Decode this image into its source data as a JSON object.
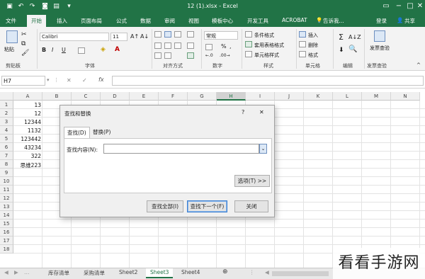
{
  "title": "12 (1).xlsx - Excel",
  "tabs": [
    "文件",
    "开始",
    "插入",
    "页面布局",
    "公式",
    "数据",
    "审阅",
    "视图",
    "模板中心",
    "开发工具",
    "ACROBAT"
  ],
  "tell_me": "告诉我...",
  "account": {
    "login": "登录",
    "share": "共享"
  },
  "ribbon": {
    "paste": "粘贴",
    "clipboard": "剪贴板",
    "font_name": "Calibri",
    "font_size": "11",
    "font_group": "字体",
    "bold": "B",
    "italic": "I",
    "underline": "U",
    "align_group": "对齐方式",
    "number_format": "常规",
    "number_group": "数字",
    "cond_format": "条件格式",
    "table_format": "套用表格格式",
    "cell_style": "单元格样式",
    "style_group": "样式",
    "insert": "插入",
    "delete": "删除",
    "format": "格式",
    "cells_group": "单元格",
    "edit_group": "编辑",
    "send_invoice": "发票查验",
    "send_invoice_group": "发票查验",
    "percent": "%"
  },
  "formula_bar": {
    "name_box": "H7",
    "cancel": "✕",
    "confirm": "✓",
    "fx": "fx",
    "value": ""
  },
  "columns": [
    "A",
    "B",
    "C",
    "D",
    "E",
    "F",
    "G",
    "H",
    "I",
    "J",
    "K",
    "L",
    "M",
    "N"
  ],
  "selected_column": "H",
  "rows": [
    "1",
    "2",
    "3",
    "4",
    "5",
    "6",
    "7",
    "8",
    "9",
    "10",
    "11",
    "12",
    "13",
    "14",
    "15",
    "16",
    "17",
    "18"
  ],
  "cells": [
    {
      "row": "1",
      "value": "13"
    },
    {
      "row": "2",
      "value": "12"
    },
    {
      "row": "3",
      "value": "12344"
    },
    {
      "row": "4",
      "value": "1132"
    },
    {
      "row": "5",
      "value": "123442"
    },
    {
      "row": "6",
      "value": "43234"
    },
    {
      "row": "7",
      "value": "322"
    },
    {
      "row": "8",
      "value": "思维223"
    }
  ],
  "sheets": [
    "库存清单",
    "采购清单",
    "Sheet2",
    "Sheet3",
    "Sheet4"
  ],
  "active_sheet": "Sheet3",
  "dialog": {
    "title": "查找和替换",
    "help": "?",
    "close": "✕",
    "tab_find": "查找(D)",
    "tab_replace": "替换(P)",
    "find_label": "查找内容(N):",
    "find_value": "",
    "options_button": "选项(T) >>",
    "find_all": "查找全部(I)",
    "find_next": "查找下一个(F)",
    "close_button": "关闭"
  },
  "watermark": "看看手游网",
  "colors": {
    "excel_green": "#217346",
    "ribbon_bg": "#f3f3f3",
    "dialog_bg": "#f0f0f0"
  }
}
